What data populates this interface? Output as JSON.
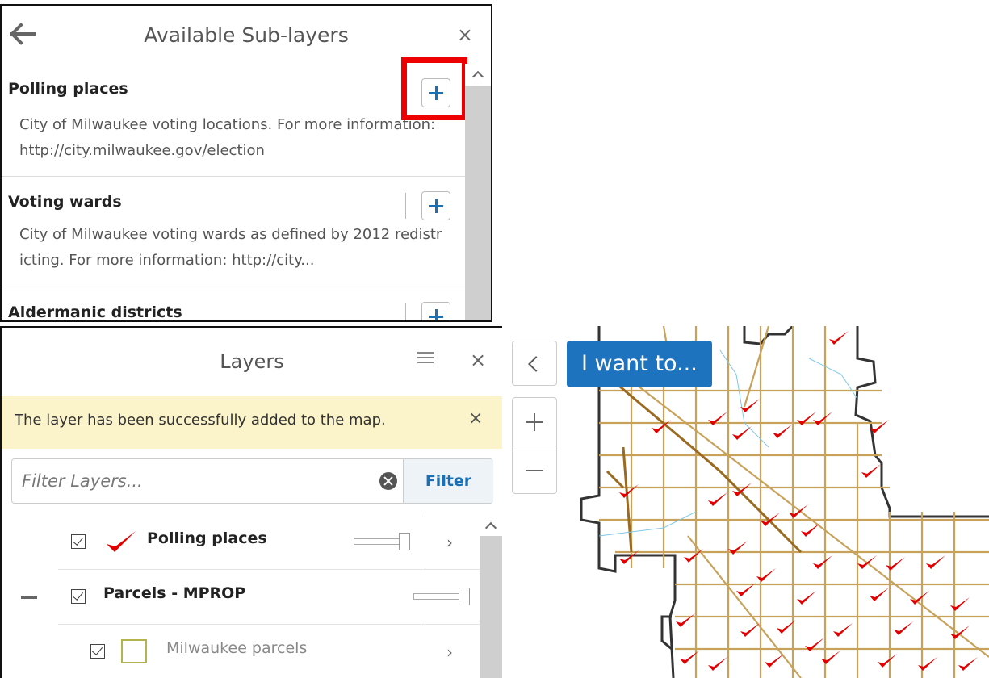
{
  "sub_layers_panel": {
    "title": "Available Sub-layers",
    "back_icon": "arrow-left-icon",
    "close_label": "×",
    "items": [
      {
        "name": "Polling places",
        "description": "City of Milwaukee voting locations. For more information: http://city.milwaukee.gov/election",
        "add_icon": "plus-icon",
        "highlighted": true
      },
      {
        "name": "Voting wards",
        "description": "City of Milwaukee voting wards as defined by 2012 redistricting. For more information: http://city...",
        "add_icon": "plus-icon",
        "highlighted": false
      },
      {
        "name": "Aldermanic districts",
        "description": "",
        "add_icon": "plus-icon",
        "highlighted": false
      }
    ],
    "highlight_color": "#ee0000"
  },
  "layers_panel": {
    "title": "Layers",
    "menu_icon": "hamburger-icon",
    "close_label": "×",
    "notice": {
      "text": "The layer has been successfully added to the map.",
      "close_label": "×",
      "background": "#fbf3c9"
    },
    "filter": {
      "placeholder": "Filter Layers...",
      "value": "",
      "clear_icon": "clear-circle-icon",
      "button_label": "Filter"
    },
    "layers": [
      {
        "name": "Polling places",
        "checked": true,
        "swatch_icon": "checkmark-icon",
        "opacity": 1.0,
        "expandable": true
      },
      {
        "name": "Parcels - MPROP",
        "checked": true,
        "collapsed_indicator": "—",
        "opacity": 1.0,
        "expandable": false
      },
      {
        "name": "Milwaukee parcels",
        "checked": true,
        "swatch_icon": "parcel-outline-swatch",
        "expandable": true
      }
    ],
    "arrow_label": "›"
  },
  "map": {
    "collapse_icon": "chevron-left-icon",
    "i_want_to_label": "I want to...",
    "zoom_in_icon": "plus-icon",
    "zoom_out_icon": "minus-icon",
    "accent_blue": "#1e73be",
    "road_color": "#c8a25a",
    "boundary_color": "#333333",
    "marker_color": "#e00000"
  }
}
